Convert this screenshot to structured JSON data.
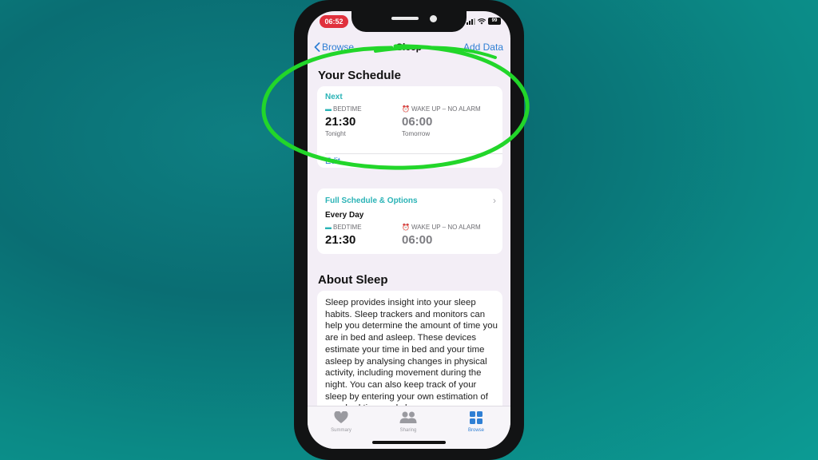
{
  "status_bar": {
    "time": "06:52",
    "battery": "99"
  },
  "nav": {
    "back_label": "Browse",
    "title": "Sleep",
    "add_data_label": "Add Data"
  },
  "schedule": {
    "title": "Your Schedule",
    "next_label": "Next",
    "bedtime_label": "BEDTIME",
    "bedtime_time": "21:30",
    "bedtime_sub": "Tonight",
    "wake_label": "WAKE UP – NO ALARM",
    "wake_time": "06:00",
    "wake_sub": "Tomorrow",
    "edit_label": "Edit"
  },
  "full_schedule": {
    "title": "Full Schedule & Options",
    "day_label": "Every Day",
    "bedtime_label": "BEDTIME",
    "bedtime_time": "21:30",
    "wake_label": "WAKE UP – NO ALARM",
    "wake_time": "06:00"
  },
  "about": {
    "title": "About Sleep",
    "text": "Sleep provides insight into your sleep habits. Sleep trackers and monitors can help you determine the amount of time you are in bed and asleep. These devices estimate your time in bed and your time asleep by analysing changes in physical activity, including movement during the night. You can also keep track of your sleep by entering your own estimation of your bed time and sleep"
  },
  "tabs": [
    {
      "label": "Summary",
      "icon": "heart-icon",
      "active": false
    },
    {
      "label": "Sharing",
      "icon": "people-icon",
      "active": false
    },
    {
      "label": "Browse",
      "icon": "grid-icon",
      "active": true
    }
  ],
  "colors": {
    "accent": "#2f7fd4",
    "teal": "#2ab3b6",
    "highlight": "#22d62a",
    "badge": "#e0303d"
  }
}
